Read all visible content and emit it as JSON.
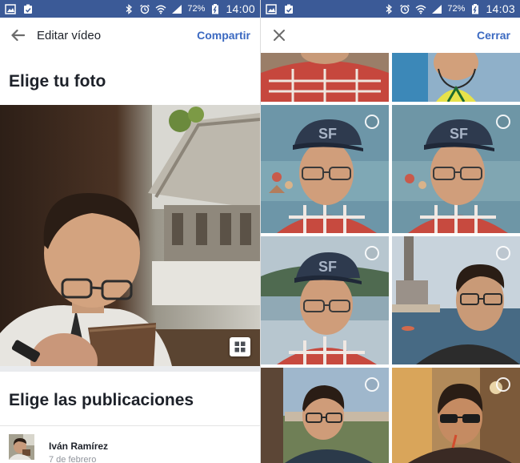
{
  "status_bar_left": {
    "battery": "72%",
    "time": "14:00"
  },
  "status_bar_right": {
    "battery": "72%",
    "time": "14:03"
  },
  "editor": {
    "title": "Editar vídeo",
    "share_label": "Compartir",
    "choose_photo_heading": "Elige tu foto",
    "choose_posts_heading": "Elige las publicaciones",
    "post": {
      "author": "Iván Ramírez",
      "date": "7 de febrero"
    }
  },
  "picker": {
    "close_label": "Cerrar",
    "logo_text": "SF"
  },
  "colors": {
    "status_bar": "#3b5a97",
    "accent": "#3b69c1",
    "separator": "#e9ebee"
  }
}
